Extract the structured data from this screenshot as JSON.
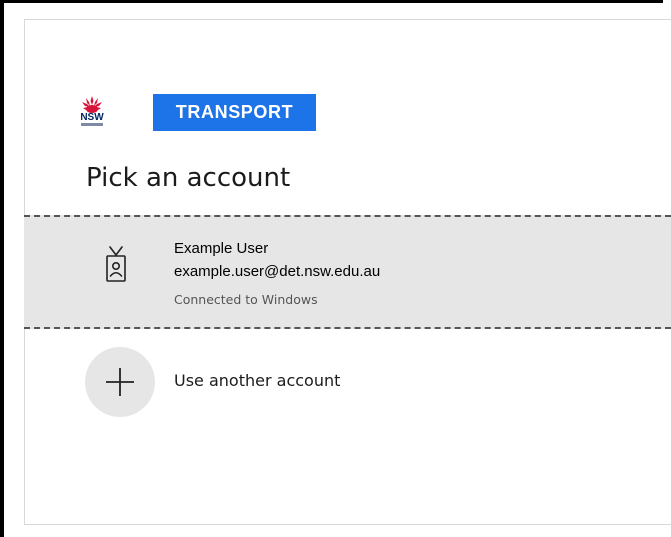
{
  "brand": {
    "nsw_mark": "NSW",
    "transport_label": "TRANSPORT",
    "colors": {
      "transport_bg": "#1d73e8",
      "waratah_red": "#d7153a",
      "nsw_navy": "#002664"
    }
  },
  "page": {
    "title": "Pick an account"
  },
  "accounts": [
    {
      "name": "Example User",
      "email": "example.user@det.nsw.edu.au",
      "status": "Connected to Windows",
      "icon": "id-badge-icon"
    }
  ],
  "add_account": {
    "label": "Use another account",
    "icon": "plus-icon"
  }
}
